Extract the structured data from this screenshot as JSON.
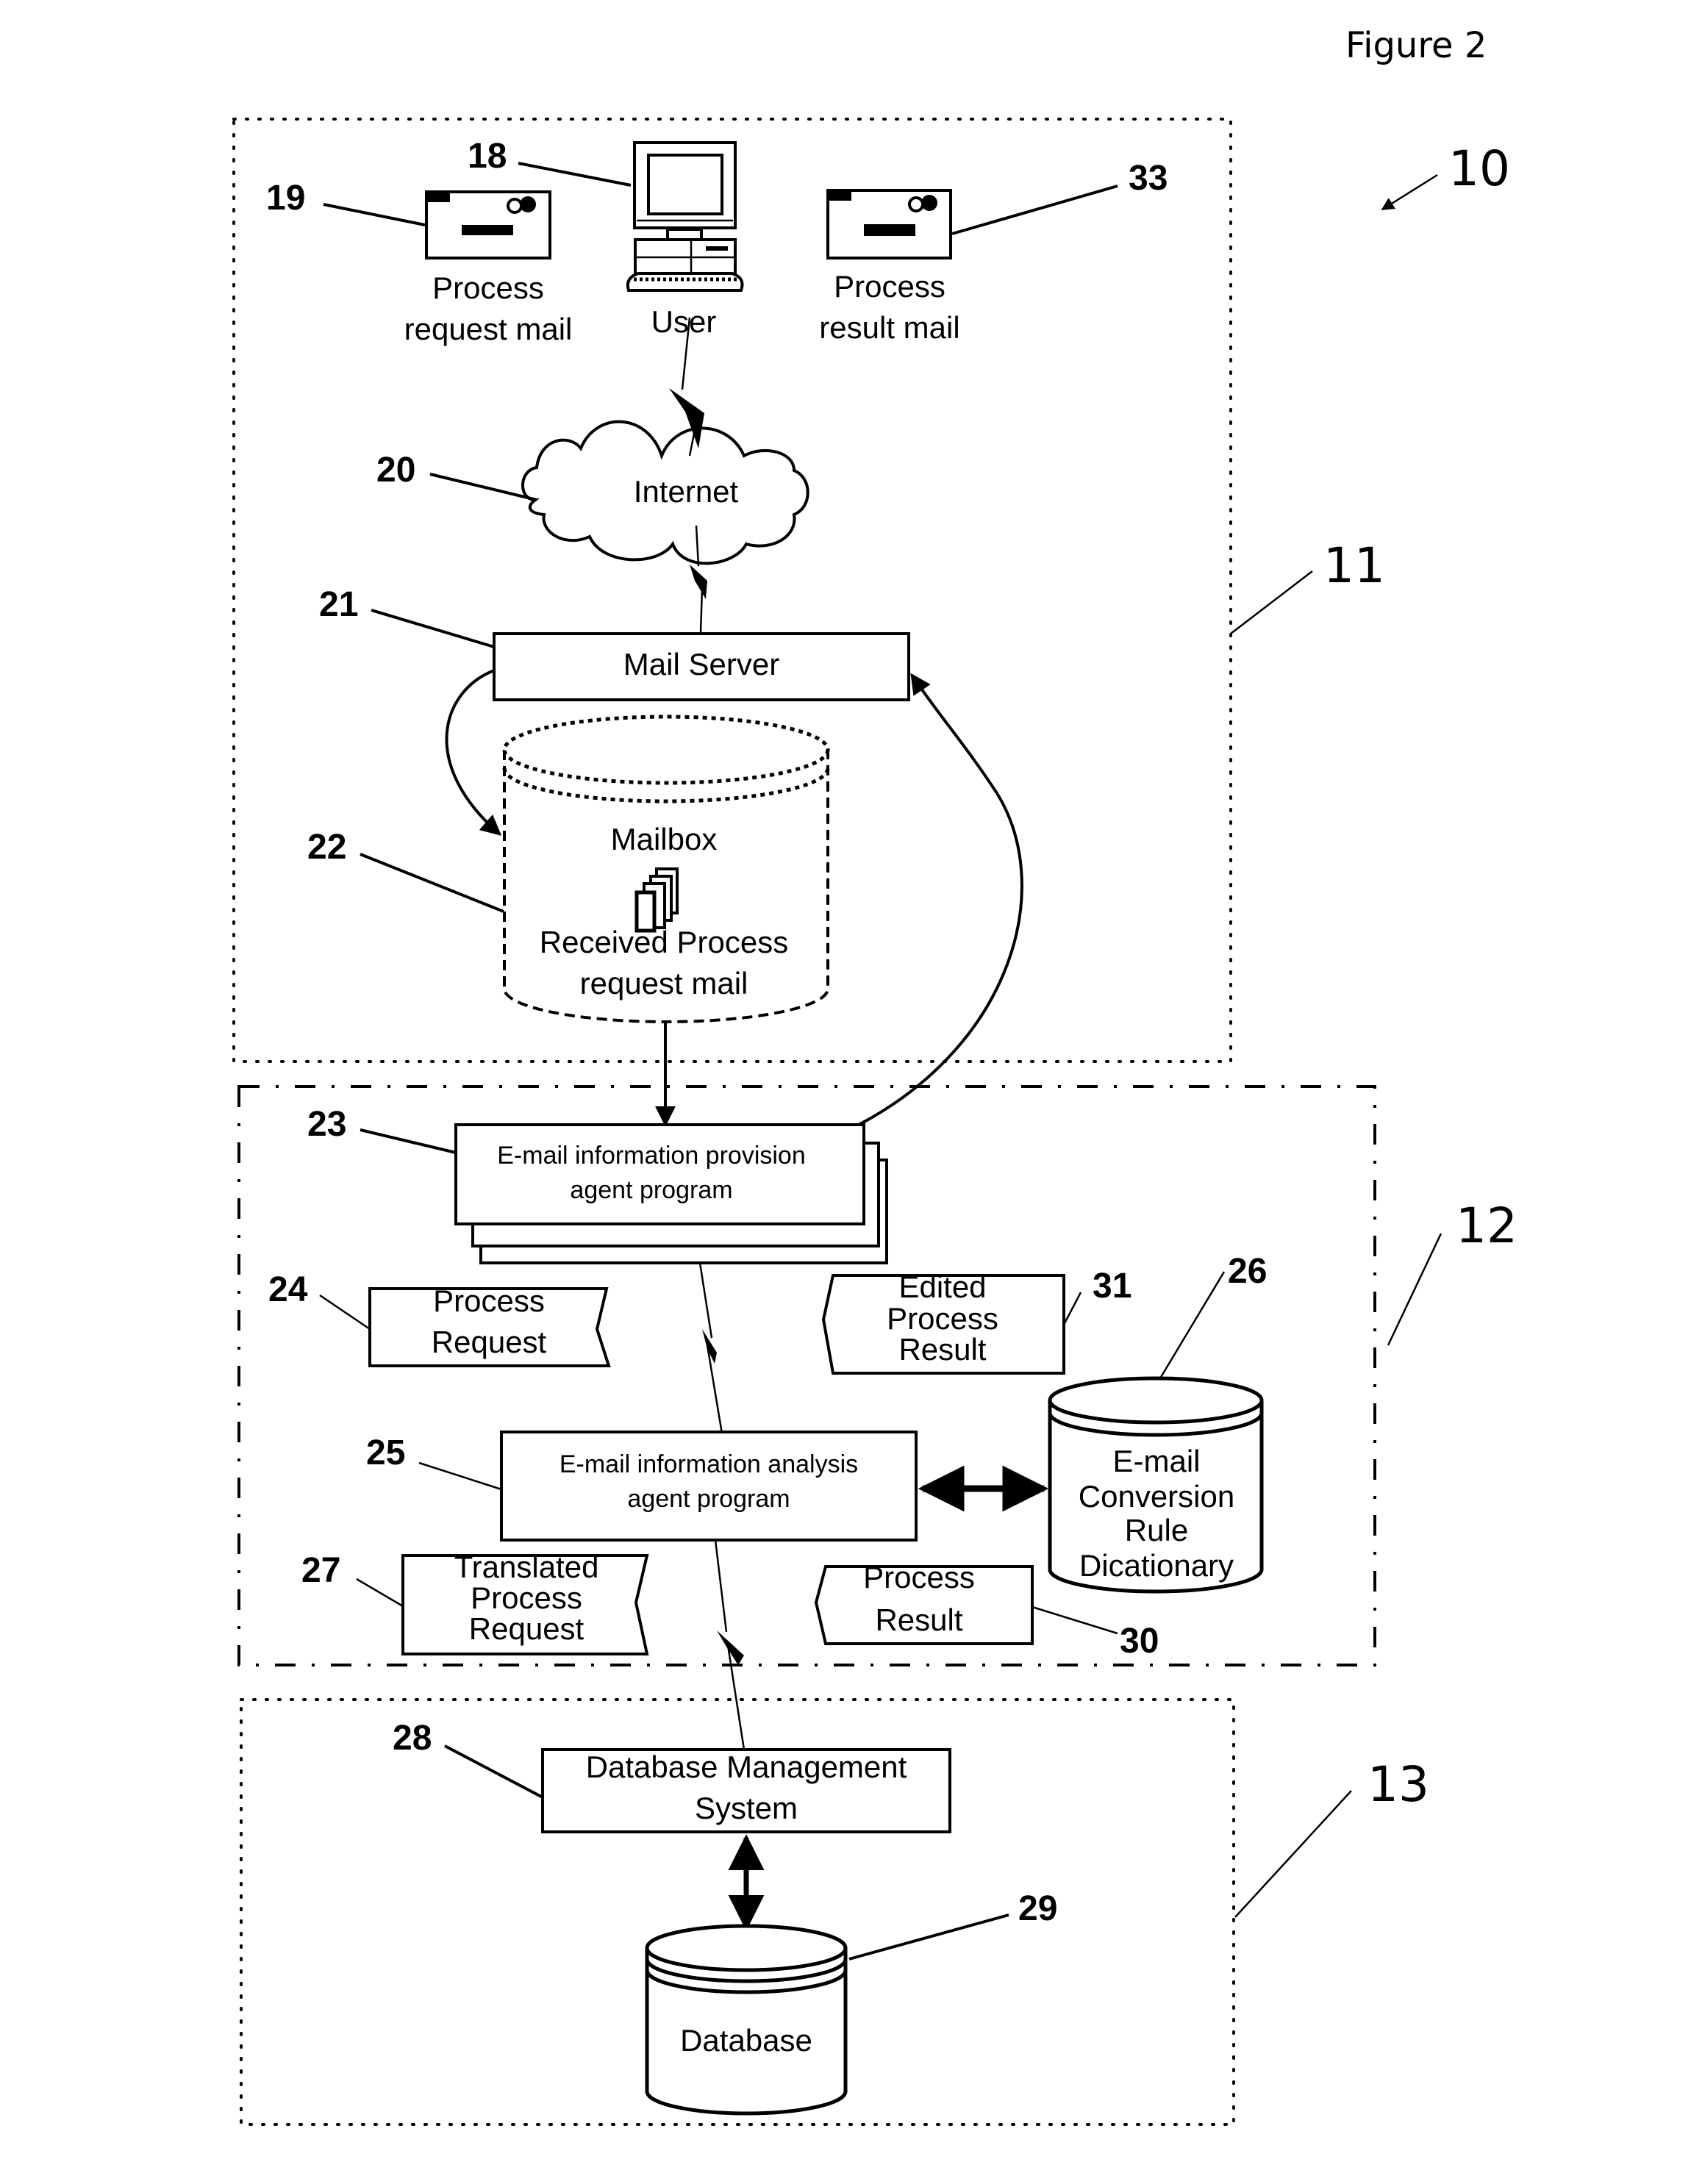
{
  "figure": {
    "title": "Figure 2",
    "system_ref": "10"
  },
  "sections": [
    {
      "ref": "11",
      "name": "mail-section"
    },
    {
      "ref": "12",
      "name": "agent-section"
    },
    {
      "ref": "13",
      "name": "database-section"
    }
  ],
  "nodes": {
    "user": {
      "ref": "18",
      "label": "User"
    },
    "process_request_mail": {
      "ref": "19",
      "lines": [
        "Process",
        "request mail"
      ]
    },
    "process_result_mail": {
      "ref": "33",
      "lines": [
        "Process",
        "result mail"
      ]
    },
    "internet": {
      "ref": "20",
      "label": "Internet"
    },
    "mail_server": {
      "ref": "21",
      "label": "Mail Server"
    },
    "mailbox": {
      "ref": "22",
      "label": "Mailbox",
      "lines": [
        "Received Process",
        "request mail"
      ]
    },
    "provision_agent": {
      "ref": "23",
      "lines": [
        "E-mail information provision",
        "agent program"
      ]
    },
    "process_request": {
      "ref": "24",
      "lines": [
        "Process",
        "Request"
      ]
    },
    "analysis_agent": {
      "ref": "25",
      "lines": [
        "E-mail information analysis",
        "agent program"
      ]
    },
    "conversion_dictionary": {
      "ref": "26",
      "lines": [
        "E-mail",
        "Conversion",
        "Rule",
        "Dicationary"
      ]
    },
    "translated_request": {
      "ref": "27",
      "lines": [
        "Translated",
        "Process",
        "Request"
      ]
    },
    "dbms": {
      "ref": "28",
      "lines": [
        "Database Management",
        "System"
      ]
    },
    "database": {
      "ref": "29",
      "label": "Database"
    },
    "process_result": {
      "ref": "30",
      "lines": [
        "Process",
        "Result"
      ]
    },
    "edited_result": {
      "ref": "31",
      "lines": [
        "Edited",
        "Process",
        "Result"
      ]
    }
  }
}
